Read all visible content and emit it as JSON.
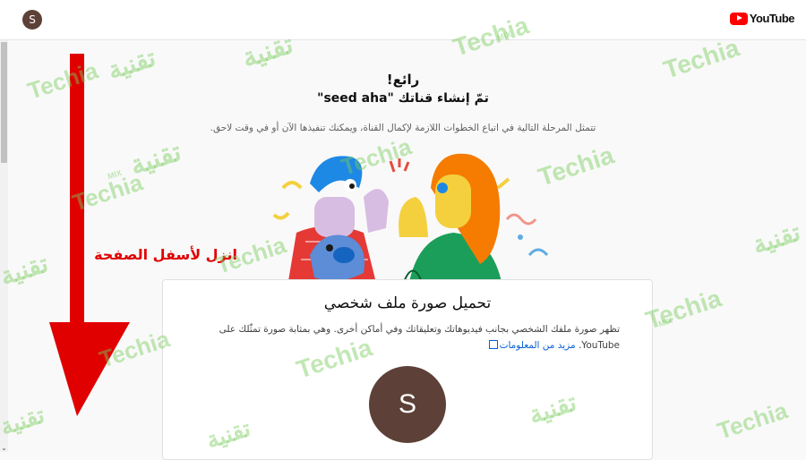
{
  "header": {
    "avatar_letter": "S",
    "logo_text": "YouTube"
  },
  "hero": {
    "great": "رائع!",
    "created": "تمّ إنشاء قناتك \"seed aha\"",
    "next_step": "تتمثل المرحلة التالية في اتباع الخطوات اللازمة لإكمال القناة، ويمكنك تنفيذها الآن أو في وقت لاحق."
  },
  "card": {
    "title": "تحميل صورة ملف شخصي",
    "description": "تظهر صورة ملفك الشخصي بجانب فيديوهاتك وتعليقاتك وفي أماكن أخرى. وهي بمثابة صورة تمثّلك على YouTube.",
    "learn_more": "مزيد من المعلومات",
    "avatar_letter": "S"
  },
  "overlay": {
    "instruction": "انزل لأسفل الصفحة"
  },
  "watermarks": {
    "latin": "Techia",
    "arabic": "تقنية",
    "mix": "MIX"
  },
  "colors": {
    "avatar": "#5d4037",
    "link": "#065fd4",
    "arrow": "#e00000",
    "youtube_red": "#ff0000"
  }
}
